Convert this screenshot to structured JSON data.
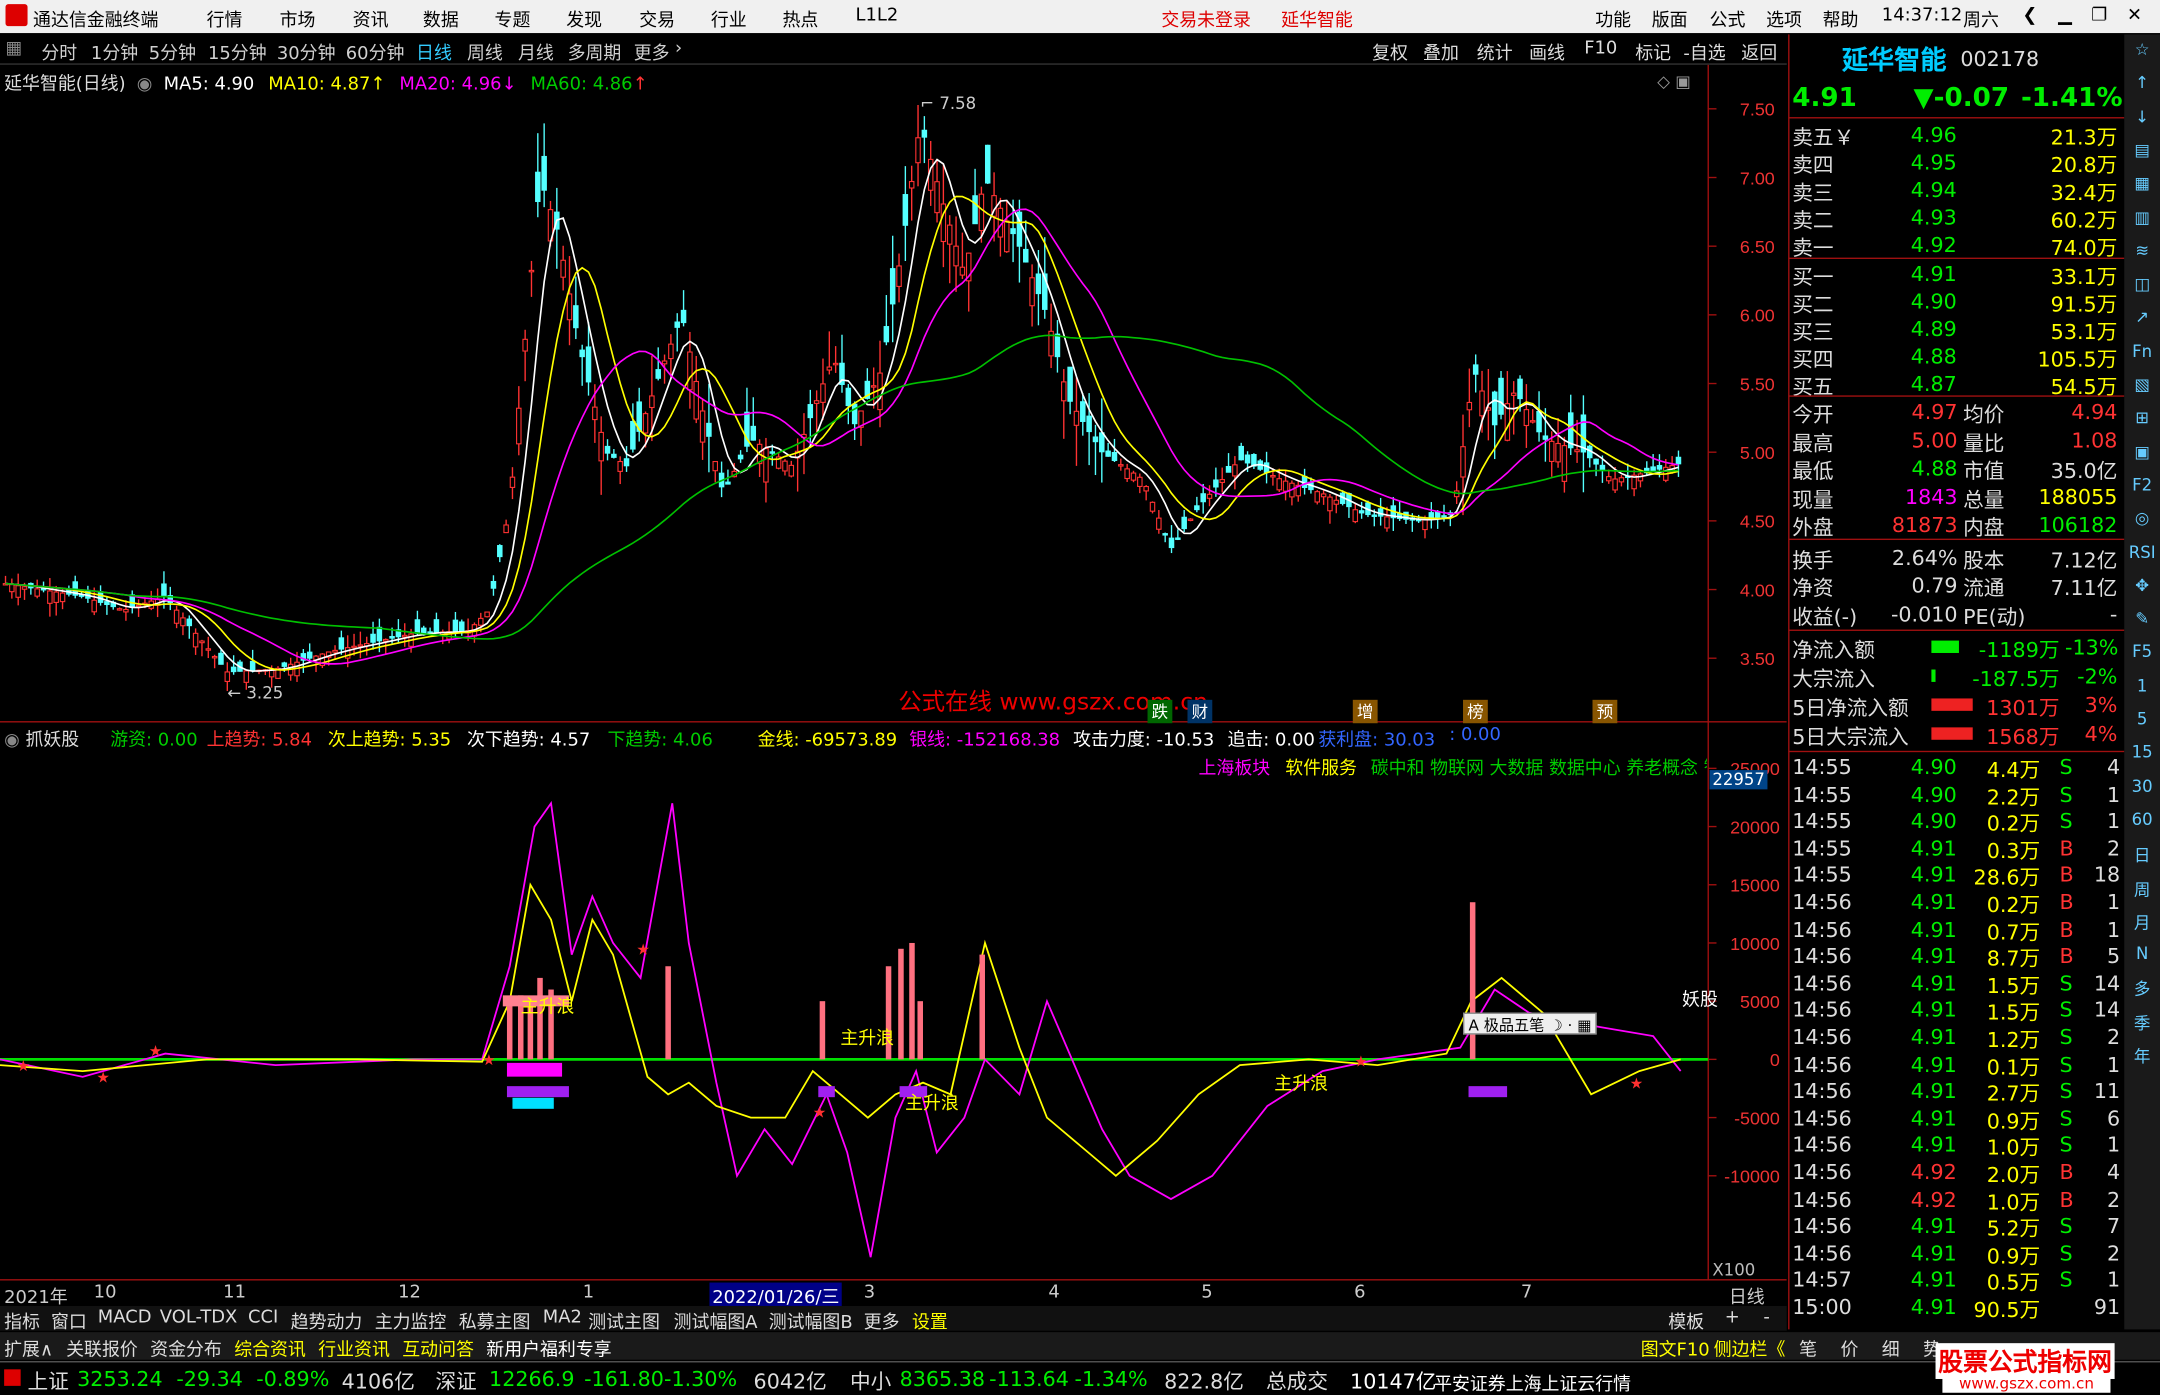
{
  "window": {
    "app_title": "通达信金融终端",
    "status_notice": "交易未登录",
    "stock_title": "延华智能",
    "clock": "14:37:12",
    "weekday": "周六",
    "menu": [
      "行情",
      "市场",
      "资讯",
      "数据",
      "专题",
      "发现",
      "交易",
      "行业",
      "热点",
      "L1L2"
    ],
    "right_menu": [
      "功能",
      "版面",
      "公式",
      "选项",
      "帮助"
    ]
  },
  "period": {
    "tabs": [
      "分时",
      "1分钟",
      "5分钟",
      "15分钟",
      "30分钟",
      "60分钟",
      "日线",
      "周线",
      "月线",
      "多周期",
      "更多"
    ],
    "active": "日线",
    "tools": [
      "复权",
      "叠加",
      "统计",
      "画线",
      "F10",
      "标记",
      "-自选",
      "返回"
    ]
  },
  "main_chart": {
    "title": "延华智能(日线)",
    "ma5_label": "MA5: 4.90",
    "ma10_label": "MA10: 4.87",
    "ma20_label": "MA20: 4.96",
    "ma60_label": "MA60: 4.86",
    "high_label": "7.58",
    "low_label": "3.25",
    "y_ticks": [
      "7.50",
      "7.00",
      "6.50",
      "6.00",
      "5.50",
      "5.00",
      "4.50",
      "4.00",
      "3.50"
    ],
    "watermark": "公式在线  www.gszx.com.cn",
    "event_tags": [
      "跌",
      "财",
      "增",
      "榜",
      "预"
    ]
  },
  "indicator": {
    "name": "抓妖股",
    "labels": [
      "游资: 0.00",
      "上趋势: 5.84",
      "次上趋势: 5.35",
      "次下趋势: 4.57",
      "下趋势: 4.06",
      "金线: -69573.89",
      "银线: -152168.38",
      "攻击力度: -10.53",
      "追击: 0.00",
      "获利盘: 30.03",
      ": 0.00"
    ],
    "sectors": [
      "上海板块",
      "软件服务",
      "碳中和 物联网 大数据 数据中心 养老概念 智"
    ],
    "y_ticks": [
      "25000",
      "20000",
      "15000",
      "10000",
      "5000",
      "0",
      "-5000",
      "-10000"
    ],
    "current_value": "22957",
    "scale_note": "X100",
    "signal_texts": [
      "主升浪",
      "主升浪",
      "主升浪",
      "主升浪",
      "妖股"
    ],
    "toolbox": "极品五笔"
  },
  "x_axis": {
    "labels": [
      "2021年",
      "10",
      "11",
      "12",
      "1",
      "2022/01/26/三",
      "3",
      "4",
      "5",
      "6",
      "7",
      "日线"
    ]
  },
  "bottom_tabs": [
    "指标",
    "窗口",
    "MACD",
    "VOL-TDX",
    "CCI",
    "趋势动力",
    "主力监控",
    "私募主图",
    "MA2",
    "测试主图",
    "测试幅图A",
    "测试幅图B",
    "更多",
    "设置"
  ],
  "bottom_tabs_right": [
    "模板",
    "+",
    "-"
  ],
  "bottom_tabs2": [
    "扩展∧",
    "关联报价",
    "资金分布",
    "综合资讯",
    "行业资讯",
    "互动问答",
    "新用户福利专享"
  ],
  "bottom_tabs2_right": [
    "图文F10",
    "侧边栏《",
    "笔",
    "价",
    "细",
    "势"
  ],
  "quote": {
    "name": "延华智能",
    "code": "002178",
    "price": "4.91",
    "change": "▼-0.07",
    "pct": "-1.41%",
    "asks": [
      {
        "label": "卖五￥",
        "price": "4.96",
        "vol": "21.3万"
      },
      {
        "label": "卖四",
        "price": "4.95",
        "vol": "20.8万"
      },
      {
        "label": "卖三",
        "price": "4.94",
        "vol": "32.4万"
      },
      {
        "label": "卖二",
        "price": "4.93",
        "vol": "60.2万"
      },
      {
        "label": "卖一",
        "price": "4.92",
        "vol": "74.0万"
      }
    ],
    "bids": [
      {
        "label": "买一",
        "price": "4.91",
        "vol": "33.1万"
      },
      {
        "label": "买二",
        "price": "4.90",
        "vol": "91.5万"
      },
      {
        "label": "买三",
        "price": "4.89",
        "vol": "53.1万"
      },
      {
        "label": "买四",
        "price": "4.88",
        "vol": "105.5万"
      },
      {
        "label": "买五",
        "price": "4.87",
        "vol": "54.5万"
      }
    ],
    "stats": [
      {
        "l1": "今开",
        "v1": "4.97",
        "l2": "均价",
        "v2": "4.94"
      },
      {
        "l1": "最高",
        "v1": "5.00",
        "l2": "量比",
        "v2": "1.08"
      },
      {
        "l1": "最低",
        "v1": "4.88",
        "l2": "市值",
        "v2": "35.0亿"
      },
      {
        "l1": "现量",
        "v1": "1843",
        "l2": "总量",
        "v2": "188055"
      },
      {
        "l1": "外盘",
        "v1": "81873",
        "l2": "内盘",
        "v2": "106182"
      },
      {
        "l1": "换手",
        "v1": "2.64%",
        "l2": "股本",
        "v2": "7.12亿"
      },
      {
        "l1": "净资",
        "v1": "0.79",
        "l2": "流通",
        "v2": "7.11亿"
      },
      {
        "l1": "收益(-)",
        "v1": "-0.010",
        "l2": "PE(动)",
        "v2": "-"
      }
    ],
    "flows": [
      {
        "label": "净流入额",
        "v": "-1189万",
        "p": "-13%"
      },
      {
        "label": "大宗流入",
        "v": "-187.5万",
        "p": "-2%"
      },
      {
        "label": "5日净流入额",
        "v": "1301万",
        "p": "3%"
      },
      {
        "label": "5日大宗流入",
        "v": "1568万",
        "p": "4%"
      }
    ],
    "ticks": [
      {
        "t": "14:55",
        "p": "4.90",
        "v": "4.4万",
        "d": "S",
        "n": "4"
      },
      {
        "t": "14:55",
        "p": "4.90",
        "v": "2.2万",
        "d": "S",
        "n": "1"
      },
      {
        "t": "14:55",
        "p": "4.90",
        "v": "0.2万",
        "d": "S",
        "n": "1"
      },
      {
        "t": "14:55",
        "p": "4.91",
        "v": "0.3万",
        "d": "B",
        "n": "2"
      },
      {
        "t": "14:55",
        "p": "4.91",
        "v": "28.6万",
        "d": "B",
        "n": "18"
      },
      {
        "t": "14:56",
        "p": "4.91",
        "v": "0.2万",
        "d": "B",
        "n": "1"
      },
      {
        "t": "14:56",
        "p": "4.91",
        "v": "0.7万",
        "d": "B",
        "n": "1"
      },
      {
        "t": "14:56",
        "p": "4.91",
        "v": "8.7万",
        "d": "B",
        "n": "5"
      },
      {
        "t": "14:56",
        "p": "4.91",
        "v": "1.5万",
        "d": "S",
        "n": "14"
      },
      {
        "t": "14:56",
        "p": "4.91",
        "v": "1.5万",
        "d": "S",
        "n": "14"
      },
      {
        "t": "14:56",
        "p": "4.91",
        "v": "1.2万",
        "d": "S",
        "n": "2"
      },
      {
        "t": "14:56",
        "p": "4.91",
        "v": "0.1万",
        "d": "S",
        "n": "1"
      },
      {
        "t": "14:56",
        "p": "4.91",
        "v": "2.7万",
        "d": "S",
        "n": "11"
      },
      {
        "t": "14:56",
        "p": "4.91",
        "v": "0.9万",
        "d": "S",
        "n": "6"
      },
      {
        "t": "14:56",
        "p": "4.91",
        "v": "1.0万",
        "d": "S",
        "n": "1"
      },
      {
        "t": "14:56",
        "p": "4.92",
        "v": "2.0万",
        "d": "B",
        "n": "4"
      },
      {
        "t": "14:56",
        "p": "4.92",
        "v": "1.0万",
        "d": "B",
        "n": "2"
      },
      {
        "t": "14:56",
        "p": "4.91",
        "v": "5.2万",
        "d": "S",
        "n": "7"
      },
      {
        "t": "14:56",
        "p": "4.91",
        "v": "0.9万",
        "d": "S",
        "n": "2"
      },
      {
        "t": "14:57",
        "p": "4.91",
        "v": "0.5万",
        "d": "S",
        "n": "1"
      },
      {
        "t": "15:00",
        "p": "4.91",
        "v": "90.5万",
        "d": "",
        "n": "91"
      }
    ]
  },
  "side_tools": [
    "☆",
    "↑",
    "↓",
    "▤",
    "▦",
    "▥",
    "≋",
    "◫",
    "↗",
    "Fn",
    "▧",
    "⊞",
    "▣",
    "F2",
    "◎",
    "RSI",
    "✥",
    "✎",
    "F5",
    "1",
    "5",
    "15",
    "30",
    "60",
    "日",
    "周",
    "月",
    "N",
    "多",
    "季",
    "年"
  ],
  "status": {
    "items": [
      {
        "k": "上证",
        "v": "3253.24",
        "c": "-29.34",
        "p": "-0.89%",
        "a": "4106亿"
      },
      {
        "k": "深证",
        "v": "12266.9",
        "c": "-161.80",
        "p": "-1.30%",
        "a": "6042亿"
      },
      {
        "k": "中小",
        "v": "8365.38",
        "c": "-113.64",
        "p": "-1.34%",
        "a": "822.8亿"
      }
    ],
    "total_label": "总成交",
    "total": "10147亿",
    "broker": "平安证券上海上证云行情",
    "brand": "股票公式指标网",
    "brand_url": "www.gszx.com.cn"
  },
  "colors": {
    "up": "#ff3232",
    "down": "#00e0e0",
    "green": "#00e000",
    "yellow": "#ffff00",
    "magenta": "#ff00ff",
    "white": "#ffffff",
    "accent_red": "#a01010"
  }
}
